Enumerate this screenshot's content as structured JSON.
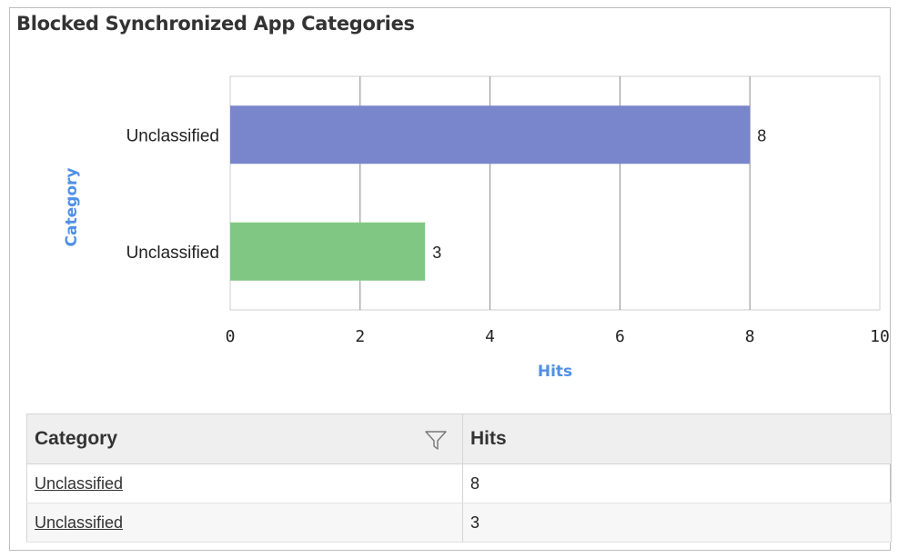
{
  "title": "Blocked Synchronized App Categories",
  "chart_data": {
    "type": "bar",
    "orientation": "horizontal",
    "categories": [
      "Unclassified",
      "Unclassified"
    ],
    "values": [
      8,
      3
    ],
    "bar_colors": [
      "#7986cb",
      "#81c784"
    ],
    "xlabel": "Hits",
    "ylabel": "Category",
    "xlim": [
      0,
      10
    ],
    "xticks": [
      "0",
      "2",
      "4",
      "6",
      "8",
      "10"
    ],
    "grid": true
  },
  "table": {
    "columns": [
      "Category",
      "Hits"
    ],
    "rows": [
      [
        "Unclassified",
        "8"
      ],
      [
        "Unclassified",
        "3"
      ]
    ]
  },
  "icons": {
    "filter": "filter-icon"
  }
}
